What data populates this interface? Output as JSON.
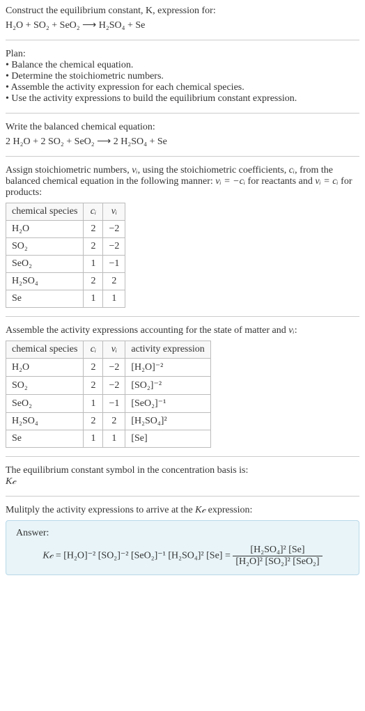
{
  "prompt": {
    "line1": "Construct the equilibrium constant, K, expression for:",
    "eq": "H₂O + SO₂ + SeO₂ ⟶ H₂SO₄ + Se"
  },
  "plan": {
    "heading": "Plan:",
    "items": [
      "Balance the chemical equation.",
      "Determine the stoichiometric numbers.",
      "Assemble the activity expression for each chemical species.",
      "Use the activity expressions to build the equilibrium constant expression."
    ]
  },
  "balanced": {
    "heading": "Write the balanced chemical equation:",
    "eq": "2 H₂O + 2 SO₂ + SeO₂ ⟶ 2 H₂SO₄ + Se"
  },
  "stoich": {
    "intro_a": "Assign stoichiometric numbers, ",
    "nu_i": "νᵢ",
    "intro_b": ", using the stoichiometric coefficients, ",
    "c_i": "cᵢ",
    "intro_c": ", from the balanced chemical equation in the following manner: ",
    "rel1": "νᵢ = −cᵢ",
    "intro_d": " for reactants and ",
    "rel2": "νᵢ = cᵢ",
    "intro_e": " for products:",
    "headers": [
      "chemical species",
      "cᵢ",
      "νᵢ"
    ],
    "rows": [
      {
        "species": "H₂O",
        "c": "2",
        "nu": "−2"
      },
      {
        "species": "SO₂",
        "c": "2",
        "nu": "−2"
      },
      {
        "species": "SeO₂",
        "c": "1",
        "nu": "−1"
      },
      {
        "species": "H₂SO₄",
        "c": "2",
        "nu": "2"
      },
      {
        "species": "Se",
        "c": "1",
        "nu": "1"
      }
    ]
  },
  "activity": {
    "intro_a": "Assemble the activity expressions accounting for the state of matter and ",
    "nu_i": "νᵢ",
    "intro_b": ":",
    "headers": [
      "chemical species",
      "cᵢ",
      "νᵢ",
      "activity expression"
    ],
    "rows": [
      {
        "species": "H₂O",
        "c": "2",
        "nu": "−2",
        "expr": "[H₂O]⁻²"
      },
      {
        "species": "SO₂",
        "c": "2",
        "nu": "−2",
        "expr": "[SO₂]⁻²"
      },
      {
        "species": "SeO₂",
        "c": "1",
        "nu": "−1",
        "expr": "[SeO₂]⁻¹"
      },
      {
        "species": "H₂SO₄",
        "c": "2",
        "nu": "2",
        "expr": "[H₂SO₄]²"
      },
      {
        "species": "Se",
        "c": "1",
        "nu": "1",
        "expr": "[Se]"
      }
    ]
  },
  "symbol": {
    "line": "The equilibrium constant symbol in the concentration basis is:",
    "kc": "K𝒸"
  },
  "multiply": {
    "line_a": "Mulitply the activity expressions to arrive at the ",
    "kc": "K𝒸",
    "line_b": " expression:"
  },
  "answer": {
    "label": "Answer:",
    "kc": "K𝒸",
    "lhs": " = [H₂O]⁻² [SO₂]⁻² [SeO₂]⁻¹ [H₂SO₄]² [Se] = ",
    "num": "[H₂SO₄]² [Se]",
    "den": "[H₂O]² [SO₂]² [SeO₂]"
  }
}
